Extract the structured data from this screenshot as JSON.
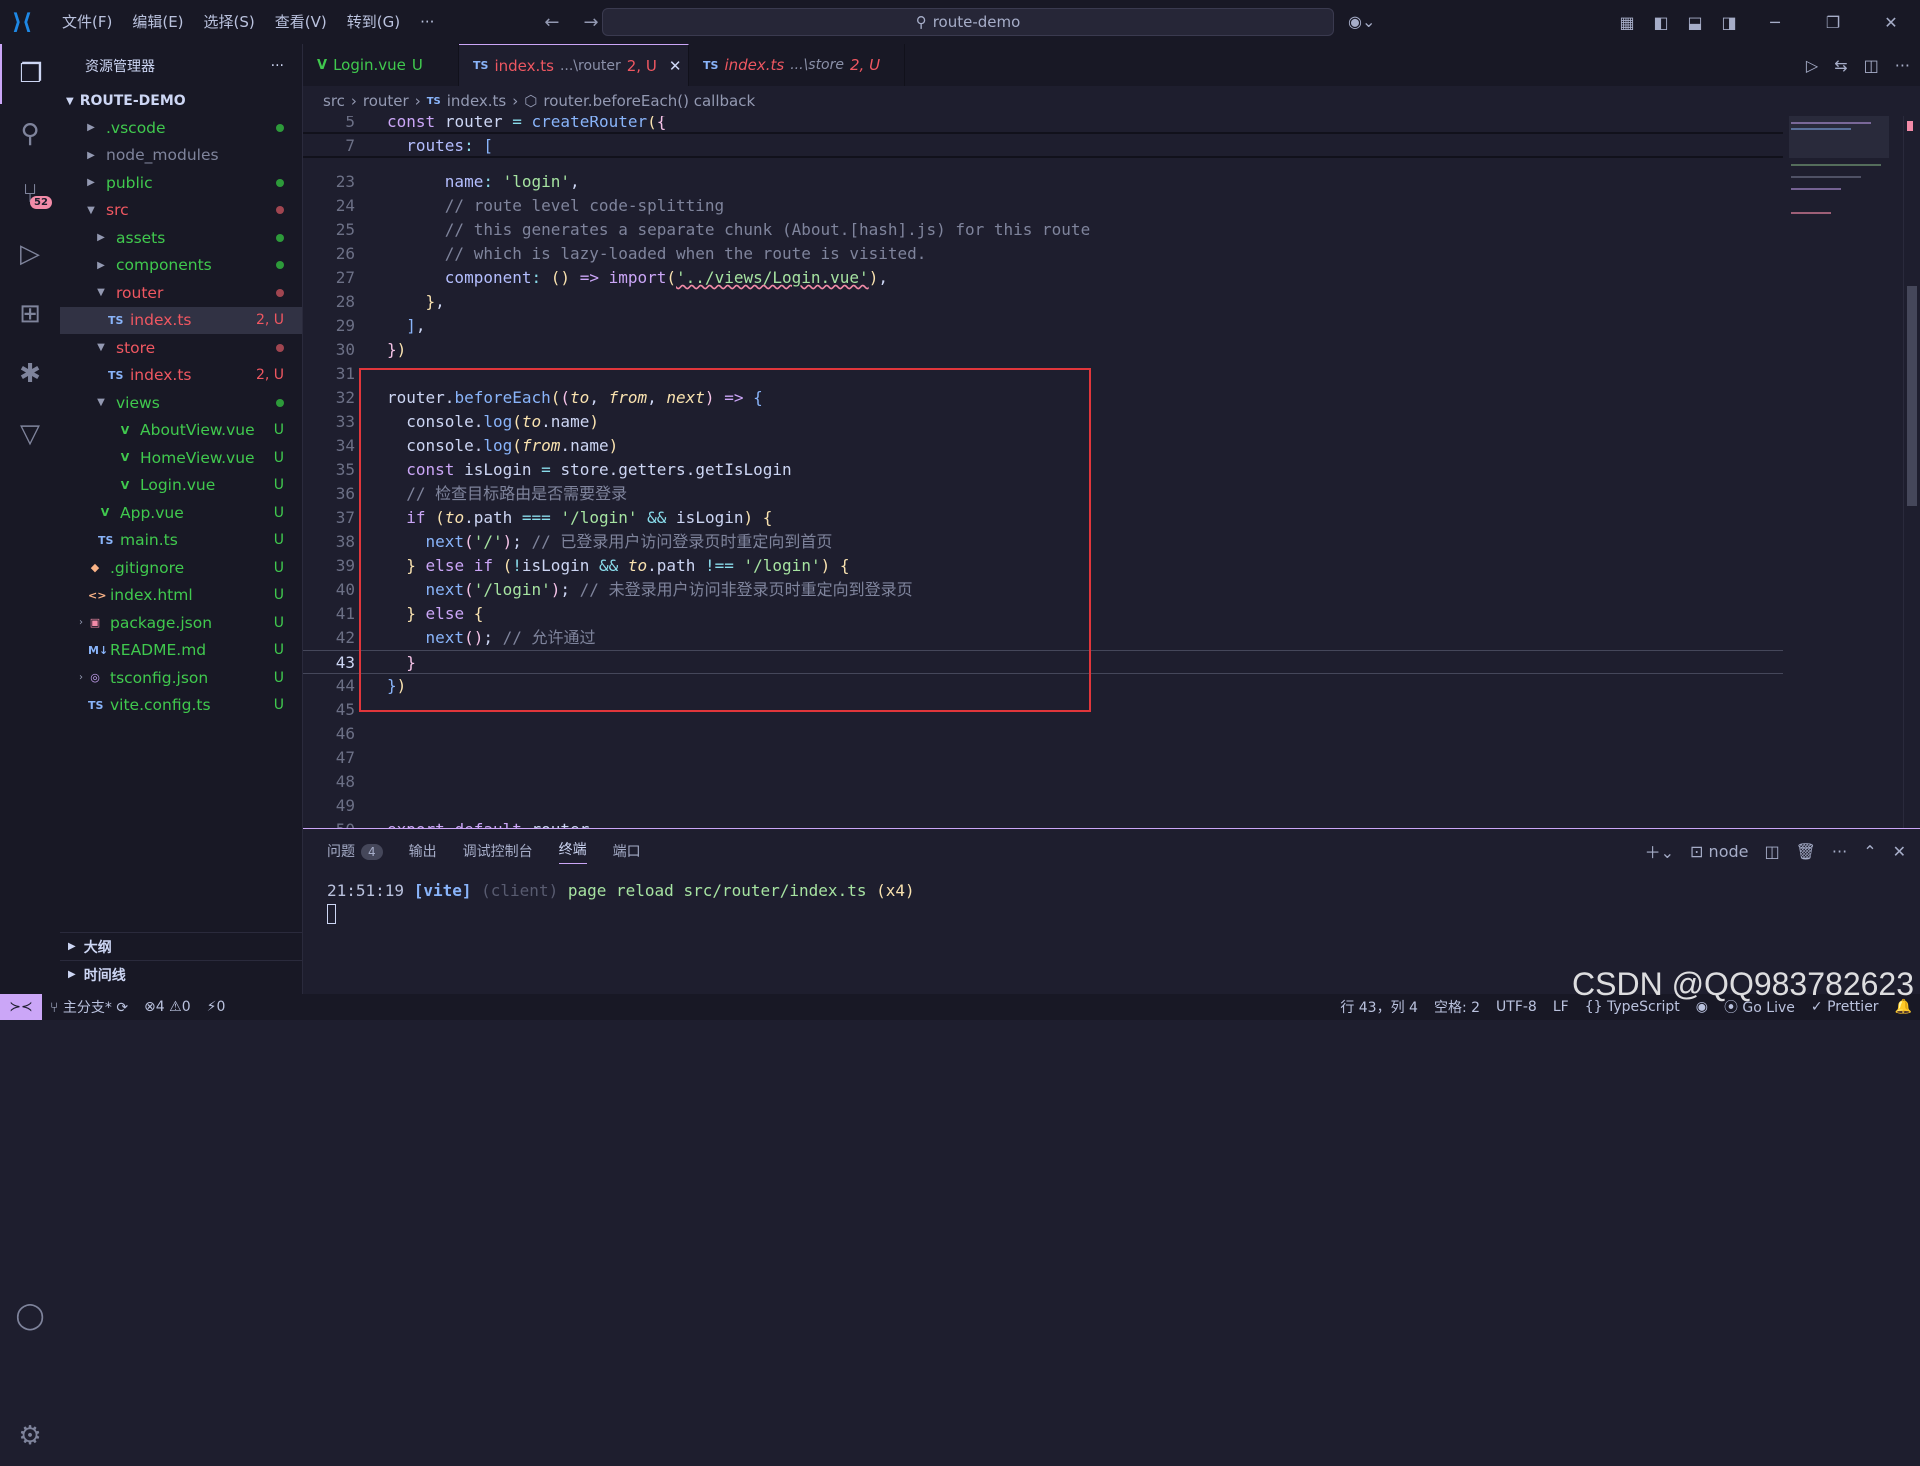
{
  "titlebar": {
    "menus": [
      "文件(F)",
      "编辑(E)",
      "选择(S)",
      "查看(V)",
      "转到(G)",
      "···"
    ],
    "search": "route-demo"
  },
  "activity": {
    "scm_badge": "52"
  },
  "sidebar": {
    "title": "资源管理器",
    "root": "ROUTE-DEMO",
    "items": [
      {
        "name": ".vscode",
        "stat": "●",
        "color": "green"
      },
      {
        "name": "node_modules",
        "stat": "",
        "color": "dim"
      },
      {
        "name": "public",
        "stat": "●",
        "color": "green"
      },
      {
        "name": "src",
        "stat": "●",
        "color": "red"
      },
      {
        "name": "assets",
        "stat": "●",
        "color": "green"
      },
      {
        "name": "components",
        "stat": "●",
        "color": "green"
      },
      {
        "name": "router",
        "stat": "●",
        "color": "red"
      },
      {
        "name": "index.ts",
        "stat": "2, U",
        "color": "red"
      },
      {
        "name": "store",
        "stat": "●",
        "color": "red"
      },
      {
        "name": "index.ts",
        "stat": "2, U",
        "color": "red"
      },
      {
        "name": "views",
        "stat": "●",
        "color": "green"
      },
      {
        "name": "AboutView.vue",
        "stat": "U",
        "color": "green"
      },
      {
        "name": "HomeView.vue",
        "stat": "U",
        "color": "green"
      },
      {
        "name": "Login.vue",
        "stat": "U",
        "color": "green"
      },
      {
        "name": "App.vue",
        "stat": "U",
        "color": "green"
      },
      {
        "name": "main.ts",
        "stat": "U",
        "color": "green"
      },
      {
        "name": ".gitignore",
        "stat": "U",
        "color": "green"
      },
      {
        "name": "index.html",
        "stat": "U",
        "color": "green"
      },
      {
        "name": "package.json",
        "stat": "U",
        "color": "green"
      },
      {
        "name": "README.md",
        "stat": "U",
        "color": "green"
      },
      {
        "name": "tsconfig.json",
        "stat": "U",
        "color": "green"
      },
      {
        "name": "vite.config.ts",
        "stat": "U",
        "color": "green"
      }
    ],
    "outline": "大纲",
    "timeline": "时间线"
  },
  "tabs": [
    {
      "label": "Login.vue",
      "desc": "",
      "stat": "U"
    },
    {
      "label": "index.ts",
      "desc": "...\\router",
      "stat": "2, U"
    },
    {
      "label": "index.ts",
      "desc": "...\\store",
      "stat": "2, U"
    }
  ],
  "breadcrumb": [
    "src",
    "router",
    "index.ts",
    "router.beforeEach() callback"
  ],
  "panel": {
    "tabs": [
      "问题",
      "输出",
      "调试控制台",
      "终端",
      "端口"
    ],
    "problems_count": "4",
    "shell": "node",
    "term_time": "21:51:19",
    "term_tag": "[vite]",
    "term_client": "(client)",
    "term_msg": "page reload src/router/index.ts",
    "term_count": "(x4)"
  },
  "status": {
    "branch": "主分支*",
    "errors": "4",
    "warnings": "0",
    "ports": "0",
    "position": "行 43，列 4",
    "spaces": "空格: 2",
    "encoding": "UTF-8",
    "eol": "LF",
    "language": "TypeScript",
    "golive": "Go Live",
    "prettier": "Prettier"
  },
  "watermark": "CSDN @QQ983782623"
}
